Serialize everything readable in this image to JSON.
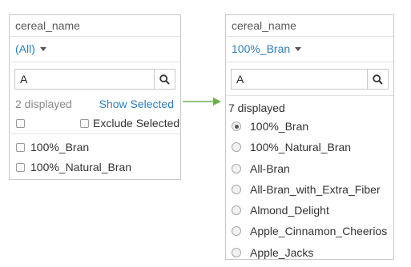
{
  "left": {
    "header": "cereal_name",
    "dropdown_value": "(All)",
    "search_value": "A",
    "displayed_count": "2 displayed",
    "show_selected_link": "Show Selected",
    "exclude_label": "Exclude Selected",
    "items": [
      {
        "label": "100%_Bran",
        "checked": false
      },
      {
        "label": "100%_Natural_Bran",
        "checked": false
      }
    ]
  },
  "right": {
    "header": "cereal_name",
    "dropdown_value": "100%_Bran",
    "search_value": "A",
    "displayed_count": "7 displayed",
    "items": [
      {
        "label": "100%_Bran",
        "selected": true
      },
      {
        "label": "100%_Natural_Bran",
        "selected": false
      },
      {
        "label": "All-Bran",
        "selected": false
      },
      {
        "label": "All-Bran_with_Extra_Fiber",
        "selected": false
      },
      {
        "label": "Almond_Delight",
        "selected": false
      },
      {
        "label": "Apple_Cinnamon_Cheerios",
        "selected": false
      },
      {
        "label": "Apple_Jacks",
        "selected": false
      }
    ]
  },
  "icons": {
    "search": "search-icon",
    "dropdown": "chevron-down-icon",
    "connector": "arrow-right-icon"
  },
  "colors": {
    "link": "#2d7dbd",
    "connector": "#6ab04c",
    "border": "#c8c8c8"
  }
}
